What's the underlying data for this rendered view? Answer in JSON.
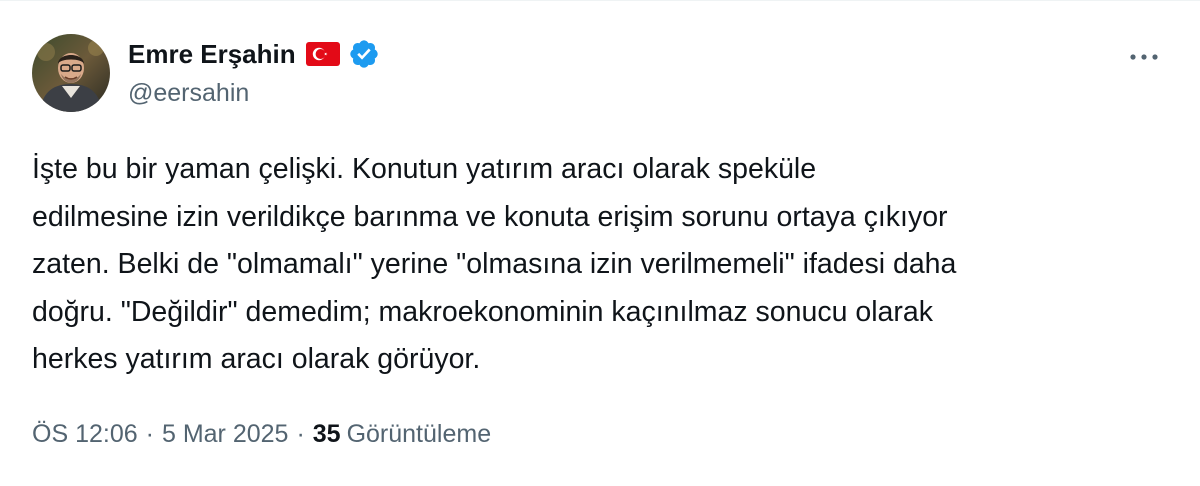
{
  "author": {
    "display_name": "Emre Erşahin",
    "handle": "@eersahin",
    "flag_icon": "turkey-flag-icon",
    "verified_icon": "verified-badge-icon",
    "verified_color": "#1d9bf0",
    "flag_color": "#e30a17"
  },
  "tweet": {
    "text": "İşte bu bir yaman çelişki. Konutun yatırım aracı olarak spekü­le\nedilmesine izin verildikçe barınma ve konuta erişim sorunu ortaya çıkıyor\nzaten. Belki de \"olmamalı\" yerine \"olmasına izin verilmemeli\" ifadesi daha\ndoğru. \"Değildir\" demedim; makroekonominin kaçınılmaz sonucu olarak\nherkes yatırım aracı olarak görüyor.",
    "time": "ÖS 12:06",
    "separator": "·",
    "date": "5 Mar 2025",
    "views_count": "35",
    "views_label": "Görüntüleme"
  },
  "actions": {
    "more_icon": "more-options-icon"
  },
  "colors": {
    "text_primary": "#0f1419",
    "text_secondary": "#536471"
  }
}
